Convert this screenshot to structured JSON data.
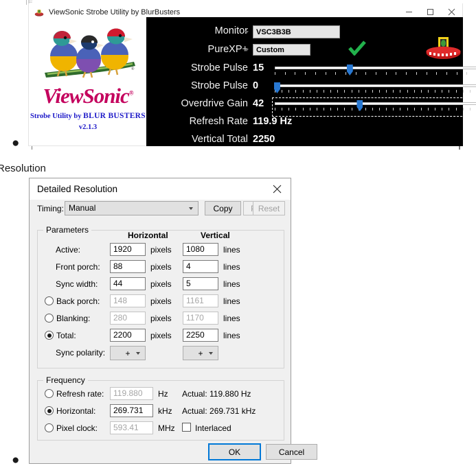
{
  "page": {
    "fragment_top": "IE",
    "section_heading": "Resolution",
    "bullet_glyph": "●"
  },
  "strobe_window": {
    "title": "ViewSonic Strobe Utility by BlurBusters",
    "titlebar_icon": "app-icon",
    "window_buttons": [
      {
        "name": "minimize-button",
        "glyph": "–"
      },
      {
        "name": "maximize-button",
        "glyph": "□"
      },
      {
        "name": "close-button",
        "glyph": "✕"
      }
    ],
    "logo": {
      "brand": "ViewSonic",
      "registered": "®",
      "tagline_prefix": "Strobe Utility by ",
      "tagline_brand": "BLUR  BUSTERS",
      "version": "v2.1.3",
      "birds_alt": "three-gouldian-finches"
    },
    "blurbusters_logo": "ufo-logo",
    "status_check": "green-checkmark",
    "controls": [
      {
        "name": "monitor",
        "label": "Monitor",
        "type": "combo",
        "value": "VSC3B3B",
        "options": [
          "VSC3B3B"
        ]
      },
      {
        "name": "purexp",
        "label": "PureXP+",
        "type": "combo",
        "value": "Custom",
        "options": [
          "Custom"
        ]
      },
      {
        "name": "strobe-pulse-width",
        "label": "Strobe Pulse",
        "type": "slider",
        "value": "15",
        "thumb_pct": 37,
        "ticks": 21,
        "focused": false
      },
      {
        "name": "strobe-pulse-phase",
        "label": "Strobe Pulse",
        "type": "slider",
        "value": "0",
        "thumb_pct": 1,
        "ticks": 30,
        "focused": false
      },
      {
        "name": "overdrive-gain",
        "label": "Overdrive Gain",
        "type": "slider",
        "value": "42",
        "thumb_pct": 42,
        "ticks": 30,
        "focused": true
      },
      {
        "name": "refresh-rate",
        "label": "Refresh Rate",
        "type": "readout",
        "value": "119.9 Hz"
      },
      {
        "name": "vertical-total",
        "label": "Vertical Total",
        "type": "readout",
        "value": "2250"
      }
    ]
  },
  "dialog": {
    "title": "Detailed Resolution",
    "close_icon": "close-icon",
    "timing": {
      "label": "Timing:",
      "value": "Manual",
      "options": [
        "Manual"
      ]
    },
    "buttons": {
      "copy": {
        "label": "Copy",
        "enabled": true
      },
      "paste": {
        "label": "Paste",
        "enabled": false
      },
      "reset": {
        "label": "Reset",
        "enabled": false
      }
    },
    "parameters": {
      "legend": "Parameters",
      "col_horizontal": "Horizontal",
      "col_vertical": "Vertical",
      "unit_pixels": "pixels",
      "unit_lines": "lines",
      "rows": [
        {
          "name": "active",
          "label": "Active:",
          "radio": null,
          "h": "1920",
          "v": "1080",
          "readonly": false
        },
        {
          "name": "front-porch",
          "label": "Front porch:",
          "radio": null,
          "h": "88",
          "v": "4",
          "readonly": false
        },
        {
          "name": "sync-width",
          "label": "Sync width:",
          "radio": null,
          "h": "44",
          "v": "5",
          "readonly": false
        },
        {
          "name": "back-porch",
          "label": "Back porch:",
          "radio": false,
          "h": "148",
          "v": "1161",
          "readonly": true
        },
        {
          "name": "blanking",
          "label": "Blanking:",
          "radio": false,
          "h": "280",
          "v": "1170",
          "readonly": true
        },
        {
          "name": "total",
          "label": "Total:",
          "radio": true,
          "h": "2200",
          "v": "2250",
          "readonly": false
        }
      ],
      "sync_polarity": {
        "label": "Sync polarity:",
        "horizontal": "+",
        "vertical": "+",
        "options": [
          "+",
          "-"
        ]
      }
    },
    "frequency": {
      "legend": "Frequency",
      "rows": [
        {
          "name": "refresh-rate",
          "label": "Refresh rate:",
          "selected": false,
          "value": "119.880",
          "unit": "Hz",
          "actual": "Actual: 119.880 Hz",
          "readonly": true
        },
        {
          "name": "horizontal",
          "label": "Horizontal:",
          "selected": true,
          "value": "269.731",
          "unit": "kHz",
          "actual": "Actual: 269.731 kHz",
          "readonly": false
        },
        {
          "name": "pixel-clock",
          "label": "Pixel clock:",
          "selected": false,
          "value": "593.41",
          "unit": "MHz",
          "actual": "",
          "readonly": true
        }
      ],
      "interlaced": {
        "label": "Interlaced",
        "checked": false
      }
    },
    "ok": "OK",
    "cancel": "Cancel"
  },
  "colors": {
    "accent_blue": "#2878d2",
    "focus_blue": "#0078d7",
    "viewsonic_magenta": "#c4005d",
    "blurbusters_blue": "#1c18c8",
    "check_green": "#22b14c",
    "panel_black": "#000000"
  }
}
